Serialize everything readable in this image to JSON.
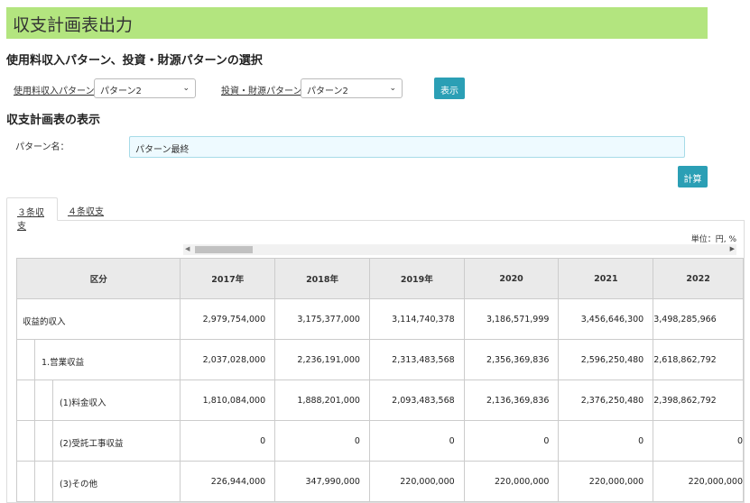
{
  "page": {
    "title": "収支計画表出力"
  },
  "selection": {
    "heading": "使用料収入パターン、投資・財源パターンの選択",
    "usage_label": "使用料収入パターン",
    "usage_value": "パターン2",
    "invest_label": "投資・財源パターン",
    "invest_value": "パターン2",
    "show_button": "表示"
  },
  "plan": {
    "heading": "収支計画表の表示",
    "name_label": "パターン名：",
    "name_value": "パターン最終",
    "calc_button": "計算"
  },
  "tabs": [
    {
      "label": "３条収支",
      "active": true
    },
    {
      "label": "４条収支",
      "active": false
    }
  ],
  "table": {
    "unit": "単位：円, %",
    "headers": [
      "区分",
      "2017年",
      "2018年",
      "2019年",
      "2020",
      "2021",
      "2022"
    ],
    "rows": [
      {
        "label": "収益的収入",
        "values": [
          "2,979,754,000",
          "3,175,377,000",
          "3,114,740,378",
          "3,186,571,999",
          "3,456,646,300",
          "3,498,285,966"
        ]
      },
      {
        "label": "1.営業収益",
        "values": [
          "2,037,028,000",
          "2,236,191,000",
          "2,313,483,568",
          "2,356,369,836",
          "2,596,250,480",
          "2,618,862,792"
        ]
      },
      {
        "label": "(1)料金収入",
        "values": [
          "1,810,084,000",
          "1,888,201,000",
          "2,093,483,568",
          "2,136,369,836",
          "2,376,250,480",
          "2,398,862,792"
        ]
      },
      {
        "label": "(2)受託工事収益",
        "values": [
          "0",
          "0",
          "0",
          "0",
          "0",
          "0"
        ]
      },
      {
        "label": "(3)その他",
        "values": [
          "226,944,000",
          "347,990,000",
          "220,000,000",
          "220,000,000",
          "220,000,000",
          "220,000,000"
        ]
      }
    ]
  }
}
